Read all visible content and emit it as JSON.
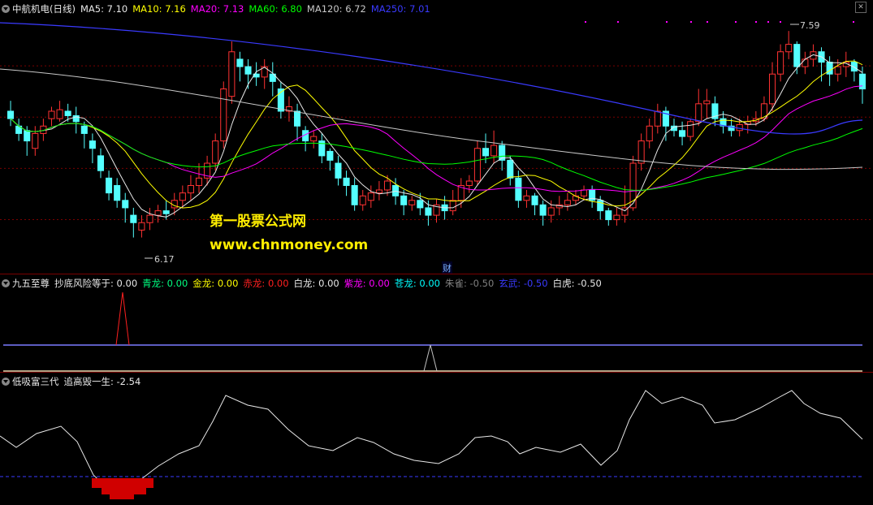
{
  "panel1": {
    "name": "中航机电(日线)",
    "indicators": [
      {
        "label": "MA5:",
        "value": "7.10",
        "color": "#e8e8e8"
      },
      {
        "label": "MA10:",
        "value": "7.16",
        "color": "#ffff00"
      },
      {
        "label": "MA20:",
        "value": "7.13",
        "color": "#ff00ff"
      },
      {
        "label": "MA60:",
        "value": "6.80",
        "color": "#00ff00"
      },
      {
        "label": "MA120:",
        "value": "6.72",
        "color": "#c8c8c8"
      },
      {
        "label": "MA250:",
        "value": "7.01",
        "color": "#3a3aff"
      }
    ],
    "high_label": "7.59",
    "low_label": "6.17",
    "watermark_cn": "第一股票公式网",
    "watermark_url": "www.chnmoney.com",
    "finance_marker": "财"
  },
  "panel2": {
    "name": "九五至尊",
    "items": [
      {
        "label": "抄底风险等于:",
        "value": "0.00",
        "color": "#e8e8e8"
      },
      {
        "label": "青龙:",
        "value": "0.00",
        "color": "#00ff80"
      },
      {
        "label": "金龙:",
        "value": "0.00",
        "color": "#ffff00"
      },
      {
        "label": "赤龙:",
        "value": "0.00",
        "color": "#ff2020"
      },
      {
        "label": "白龙:",
        "value": "0.00",
        "color": "#e8e8e8"
      },
      {
        "label": "紫龙:",
        "value": "0.00",
        "color": "#ff00ff"
      },
      {
        "label": "苍龙:",
        "value": "0.00",
        "color": "#00ffff"
      },
      {
        "label": "朱雀:",
        "value": "-0.50",
        "color": "#808080"
      },
      {
        "label": "玄武:",
        "value": "-0.50",
        "color": "#3a3aff"
      },
      {
        "label": "白虎:",
        "value": "-0.50",
        "color": "#e8e8e8"
      }
    ]
  },
  "panel3": {
    "name": "低吸富三代",
    "items": [
      {
        "label": "追高毁一生:",
        "value": "-2.54",
        "color": "#e8e8e8"
      }
    ]
  },
  "chart_data": {
    "type": "candlestick",
    "price_range": [
      6.05,
      7.7
    ],
    "candles": [
      [
        7.05,
        7.0,
        7.12,
        6.95
      ],
      [
        6.95,
        6.9,
        7.0,
        6.85
      ],
      [
        6.92,
        6.85,
        6.95,
        6.75
      ],
      [
        6.8,
        6.9,
        6.95,
        6.75
      ],
      [
        6.9,
        6.95,
        7.0,
        6.85
      ],
      [
        7.0,
        7.05,
        7.08,
        6.95
      ],
      [
        7.0,
        7.06,
        7.12,
        6.98
      ],
      [
        7.05,
        7.02,
        7.1,
        6.98
      ],
      [
        7.02,
        6.98,
        7.08,
        6.9
      ],
      [
        6.95,
        6.9,
        6.98,
        6.8
      ],
      [
        6.85,
        6.8,
        6.9,
        6.7
      ],
      [
        6.75,
        6.65,
        6.8,
        6.6
      ],
      [
        6.6,
        6.5,
        6.65,
        6.45
      ],
      [
        6.55,
        6.45,
        6.6,
        6.4
      ],
      [
        6.45,
        6.4,
        6.5,
        6.3
      ],
      [
        6.35,
        6.3,
        6.4,
        6.2
      ],
      [
        6.25,
        6.3,
        6.35,
        6.2
      ],
      [
        6.3,
        6.35,
        6.4,
        6.25
      ],
      [
        6.35,
        6.38,
        6.42,
        6.3
      ],
      [
        6.38,
        6.36,
        6.45,
        6.32
      ],
      [
        6.4,
        6.45,
        6.5,
        6.35
      ],
      [
        6.45,
        6.5,
        6.55,
        6.4
      ],
      [
        6.5,
        6.55,
        6.62,
        6.45
      ],
      [
        6.55,
        6.6,
        6.7,
        6.5
      ],
      [
        6.6,
        6.7,
        6.75,
        6.55
      ],
      [
        6.7,
        6.85,
        6.9,
        6.65
      ],
      [
        6.85,
        7.2,
        7.25,
        6.8
      ],
      [
        7.15,
        7.45,
        7.52,
        7.1
      ],
      [
        7.4,
        7.35,
        7.45,
        7.25
      ],
      [
        7.35,
        7.3,
        7.4,
        7.2
      ],
      [
        7.3,
        7.28,
        7.38,
        7.22
      ],
      [
        7.28,
        7.35,
        7.4,
        7.2
      ],
      [
        7.3,
        7.25,
        7.38,
        7.15
      ],
      [
        7.2,
        7.05,
        7.25,
        7.0
      ],
      [
        7.05,
        7.08,
        7.15,
        6.98
      ],
      [
        7.05,
        6.95,
        7.1,
        6.85
      ],
      [
        6.92,
        6.85,
        6.95,
        6.78
      ],
      [
        6.85,
        6.88,
        6.92,
        6.8
      ],
      [
        6.85,
        6.75,
        6.9,
        6.7
      ],
      [
        6.78,
        6.72,
        6.8,
        6.65
      ],
      [
        6.7,
        6.6,
        6.75,
        6.55
      ],
      [
        6.6,
        6.55,
        6.65,
        6.48
      ],
      [
        6.55,
        6.42,
        6.6,
        6.38
      ],
      [
        6.42,
        6.48,
        6.52,
        6.38
      ],
      [
        6.45,
        6.5,
        6.55,
        6.4
      ],
      [
        6.5,
        6.52,
        6.58,
        6.45
      ],
      [
        6.52,
        6.58,
        6.62,
        6.48
      ],
      [
        6.55,
        6.48,
        6.6,
        6.42
      ],
      [
        6.48,
        6.42,
        6.52,
        6.35
      ],
      [
        6.42,
        6.45,
        6.48,
        6.38
      ],
      [
        6.45,
        6.4,
        6.5,
        6.35
      ],
      [
        6.4,
        6.35,
        6.45,
        6.28
      ],
      [
        6.35,
        6.42,
        6.46,
        6.3
      ],
      [
        6.42,
        6.38,
        6.48,
        6.32
      ],
      [
        6.38,
        6.45,
        6.52,
        6.35
      ],
      [
        6.45,
        6.55,
        6.6,
        6.4
      ],
      [
        6.55,
        6.58,
        6.62,
        6.5
      ],
      [
        6.58,
        6.8,
        6.85,
        6.55
      ],
      [
        6.8,
        6.75,
        6.9,
        6.7
      ],
      [
        6.75,
        6.82,
        6.92,
        6.7
      ],
      [
        6.82,
        6.72,
        6.85,
        6.65
      ],
      [
        6.72,
        6.6,
        6.75,
        6.55
      ],
      [
        6.6,
        6.45,
        6.65,
        6.4
      ],
      [
        6.45,
        6.48,
        6.52,
        6.4
      ],
      [
        6.48,
        6.42,
        6.5,
        6.35
      ],
      [
        6.42,
        6.35,
        6.45,
        6.28
      ],
      [
        6.35,
        6.4,
        6.45,
        6.3
      ],
      [
        6.4,
        6.42,
        6.48,
        6.35
      ],
      [
        6.42,
        6.45,
        6.5,
        6.38
      ],
      [
        6.45,
        6.48,
        6.52,
        6.42
      ],
      [
        6.48,
        6.52,
        6.55,
        6.45
      ],
      [
        6.52,
        6.45,
        6.55,
        6.4
      ],
      [
        6.45,
        6.38,
        6.48,
        6.32
      ],
      [
        6.38,
        6.32,
        6.4,
        6.28
      ],
      [
        6.32,
        6.35,
        6.4,
        6.28
      ],
      [
        6.35,
        6.4,
        6.55,
        6.3
      ],
      [
        6.4,
        6.7,
        6.75,
        6.38
      ],
      [
        6.7,
        6.85,
        6.9,
        6.65
      ],
      [
        6.85,
        6.95,
        7.0,
        6.8
      ],
      [
        6.95,
        7.05,
        7.1,
        6.9
      ],
      [
        7.05,
        6.95,
        7.08,
        6.85
      ],
      [
        6.95,
        6.92,
        7.0,
        6.88
      ],
      [
        6.92,
        6.88,
        6.98,
        6.82
      ],
      [
        6.88,
        6.98,
        7.0,
        6.85
      ],
      [
        6.98,
        7.1,
        7.2,
        6.95
      ],
      [
        7.1,
        7.12,
        7.2,
        7.0
      ],
      [
        7.1,
        7.0,
        7.15,
        6.95
      ],
      [
        7.0,
        6.95,
        7.05,
        6.9
      ],
      [
        6.95,
        6.92,
        7.0,
        6.88
      ],
      [
        6.92,
        6.96,
        7.0,
        6.88
      ],
      [
        6.96,
        6.98,
        7.02,
        6.9
      ],
      [
        6.98,
        7.0,
        7.05,
        6.95
      ],
      [
        7.0,
        7.1,
        7.15,
        6.98
      ],
      [
        7.1,
        7.3,
        7.38,
        7.05
      ],
      [
        7.3,
        7.45,
        7.5,
        7.25
      ],
      [
        7.45,
        7.5,
        7.59,
        7.4
      ],
      [
        7.5,
        7.35,
        7.52,
        7.3
      ],
      [
        7.35,
        7.4,
        7.45,
        7.3
      ],
      [
        7.4,
        7.45,
        7.5,
        7.35
      ],
      [
        7.45,
        7.38,
        7.48,
        7.25
      ],
      [
        7.38,
        7.3,
        7.42,
        7.22
      ],
      [
        7.3,
        7.35,
        7.4,
        7.25
      ],
      [
        7.35,
        7.38,
        7.45,
        7.28
      ],
      [
        7.38,
        7.32,
        7.4,
        7.25
      ],
      [
        7.3,
        7.2,
        7.35,
        7.1
      ]
    ]
  }
}
